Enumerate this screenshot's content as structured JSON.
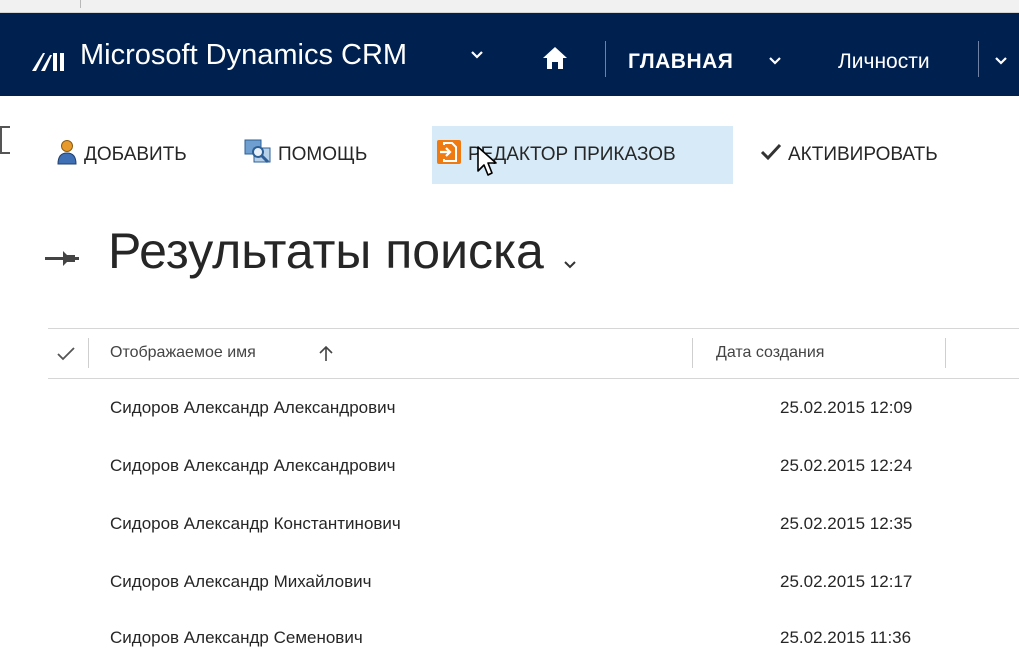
{
  "app": {
    "brand": "Microsoft Dynamics CRM",
    "nav_main": "ГЛАВНАЯ",
    "nav_entity": "Личности"
  },
  "commands": {
    "add": "ДОБАВИТЬ",
    "help": "ПОМОЩЬ",
    "order_editor": "РЕДАКТОР ПРИКАЗОВ",
    "activate": "АКТИВИРОВАТЬ"
  },
  "view": {
    "title": "Результаты поиска"
  },
  "grid": {
    "columns": [
      "Отображаемое имя",
      "Дата создания"
    ],
    "sorted_column": "Отображаемое имя",
    "sort_direction": "ascending",
    "rows": [
      {
        "name": "Сидоров Александр Александрович",
        "date": "25.02.2015 12:09"
      },
      {
        "name": "Сидоров Александр Александрович",
        "date": "25.02.2015 12:24"
      },
      {
        "name": "Сидоров Александр Константинович",
        "date": "25.02.2015 12:35"
      },
      {
        "name": "Сидоров Александр Михайлович",
        "date": "25.02.2015 12:17"
      },
      {
        "name": "Сидоров Александр Семенович",
        "date": "25.02.2015 11:36"
      }
    ]
  },
  "colors": {
    "nav_background": "#002050",
    "command_hover": "#d6eaf7",
    "add_icon": "#e79a2b",
    "editor_icon": "#f07a12"
  }
}
